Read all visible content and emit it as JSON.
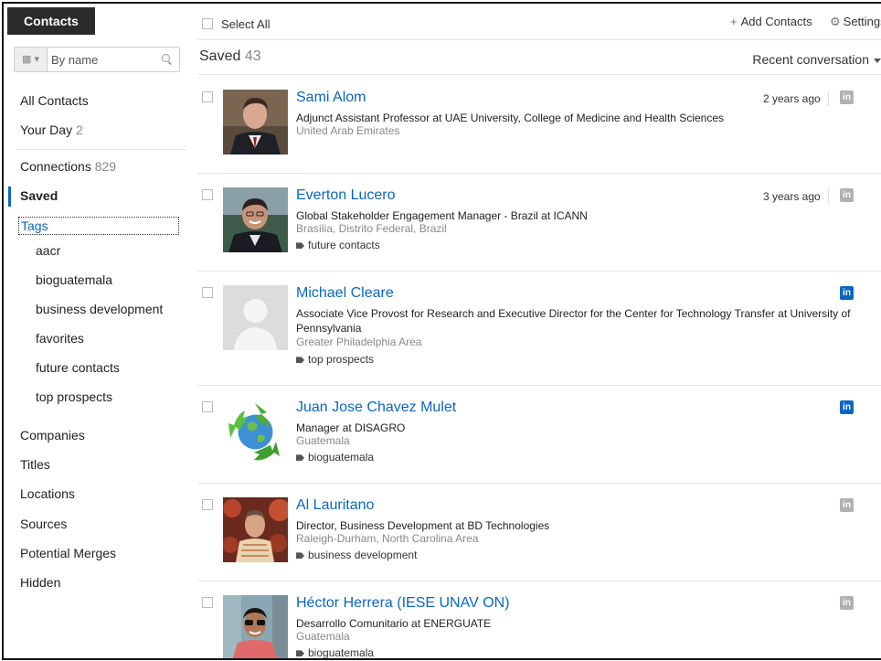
{
  "sidebar": {
    "header": "Contacts",
    "filter": {
      "type_icon": "contacts-filter-icon",
      "placeholder": "By name"
    },
    "items": [
      {
        "label": "All Contacts",
        "count": ""
      },
      {
        "label": "Your Day",
        "count": "2"
      },
      {
        "label": "Connections",
        "count": "829"
      },
      {
        "label": "Saved",
        "count": ""
      },
      {
        "label": "Tags",
        "count": ""
      }
    ],
    "tags": [
      "aacr",
      "bioguatemala",
      "business development",
      "favorites",
      "future contacts",
      "top prospects"
    ],
    "more_items": [
      "Companies",
      "Titles",
      "Locations",
      "Sources",
      "Potential Merges",
      "Hidden"
    ]
  },
  "toolbar": {
    "select_all": "Select All",
    "add_contacts": "Add Contacts",
    "settings": "Settings"
  },
  "list": {
    "title": "Saved",
    "count": "43",
    "sort": "Recent conversation"
  },
  "contacts": [
    {
      "name": "Sami Alom",
      "title": "Adjunct Assistant Professor at UAE University, College of Medicine and Health Sciences",
      "location": "United Arab Emirates",
      "tag": "",
      "time": "2 years ago",
      "badge_color": "#b1b1b1"
    },
    {
      "name": "Everton Lucero",
      "title": "Global Stakeholder Engagement Manager - Brazil at ICANN",
      "location": "Brasília, Distrito Federal, Brazil",
      "tag": "future contacts",
      "time": "3 years ago",
      "badge_color": "#b1b1b1"
    },
    {
      "name": "Michael Cleare",
      "title": "Associate Vice Provost for Research and Executive Director for the Center for Technology Transfer at University of Pennsylvania",
      "location": "Greater Philadelphia Area",
      "tag": "top prospects",
      "time": "",
      "badge_color": "#0a66c2"
    },
    {
      "name": "Juan Jose Chavez Mulet",
      "title": "Manager at DISAGRO",
      "location": "Guatemala",
      "tag": "bioguatemala",
      "time": "",
      "badge_color": "#0a66c2"
    },
    {
      "name": "Al Lauritano",
      "title": "Director, Business Development at BD Technologies",
      "location": "Raleigh-Durham, North Carolina Area",
      "tag": "business development",
      "time": "",
      "badge_color": "#b1b1b1"
    },
    {
      "name": "Héctor Herrera (IESE UNAV ON)",
      "title": "Desarrollo Comunitario at ENERGUATE",
      "location": "Guatemala",
      "tag": "bioguatemala",
      "time": "",
      "badge_color": "#b1b1b1"
    }
  ],
  "linkedin_badge_text": "in",
  "colors": {
    "link": "#0a66c2",
    "header_bg": "#2b2b2b"
  }
}
